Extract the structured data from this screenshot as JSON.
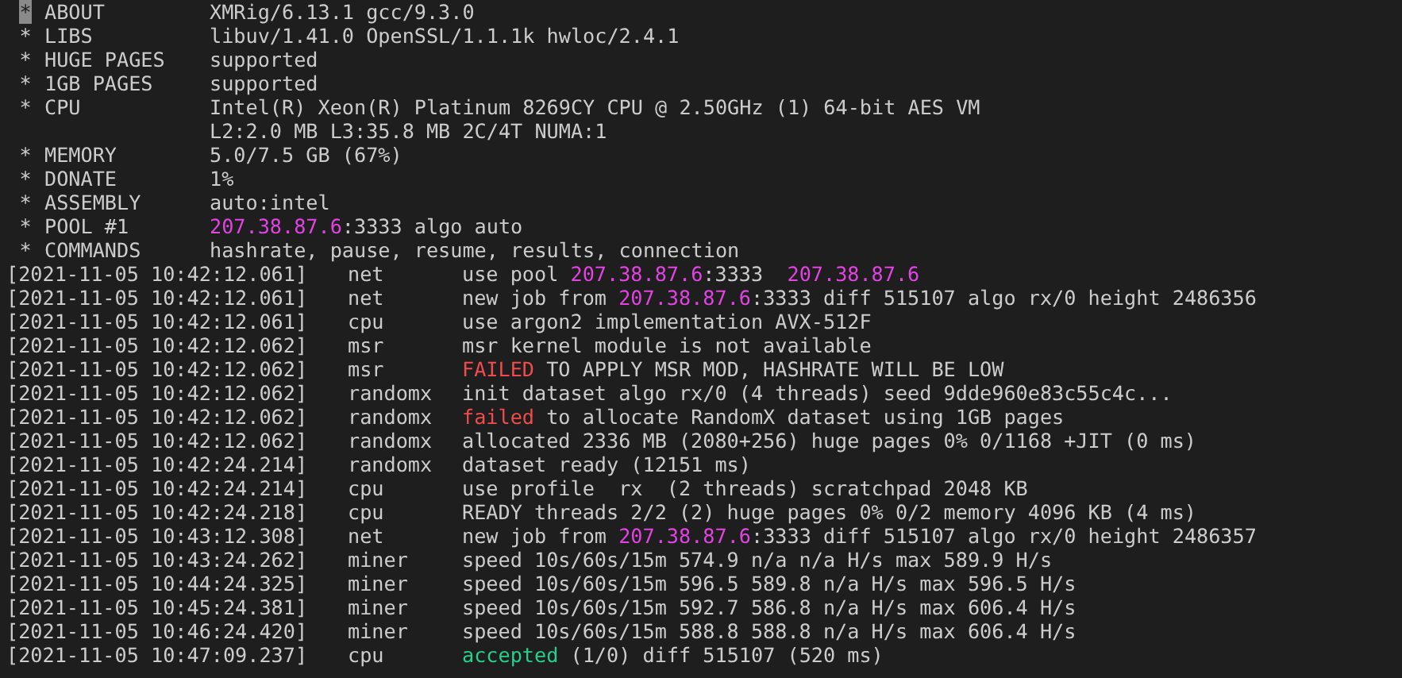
{
  "summary": [
    {
      "bullet": "*",
      "cursor": true,
      "label": "ABOUT",
      "value": [
        [
          {
            "text": "XMRig/6.13.1 gcc/9.3.0",
            "kind": "plain"
          }
        ]
      ]
    },
    {
      "bullet": "*",
      "cursor": false,
      "label": "LIBS",
      "value": [
        [
          {
            "text": "libuv/1.41.0 OpenSSL/1.1.1k hwloc/2.4.1",
            "kind": "plain"
          }
        ]
      ]
    },
    {
      "bullet": "*",
      "cursor": false,
      "label": "HUGE PAGES",
      "value": [
        [
          {
            "text": "supported",
            "kind": "plain"
          }
        ]
      ]
    },
    {
      "bullet": "*",
      "cursor": false,
      "label": "1GB PAGES",
      "value": [
        [
          {
            "text": "supported",
            "kind": "plain"
          }
        ]
      ]
    },
    {
      "bullet": "*",
      "cursor": false,
      "label": "CPU",
      "value": [
        [
          {
            "text": "Intel(R) Xeon(R) Platinum 8269CY CPU @ 2.50GHz (1) 64-bit AES VM",
            "kind": "plain"
          }
        ],
        [
          {
            "text": "L2:2.0 MB L3:35.8 MB 2C/4T NUMA:1",
            "kind": "plain"
          }
        ]
      ]
    },
    {
      "bullet": "*",
      "cursor": false,
      "label": "MEMORY",
      "value": [
        [
          {
            "text": "5.0/7.5 GB (67%)",
            "kind": "plain"
          }
        ]
      ]
    },
    {
      "bullet": "*",
      "cursor": false,
      "label": "DONATE",
      "value": [
        [
          {
            "text": "1%",
            "kind": "plain"
          }
        ]
      ]
    },
    {
      "bullet": "*",
      "cursor": false,
      "label": "ASSEMBLY",
      "value": [
        [
          {
            "text": "auto:intel",
            "kind": "plain"
          }
        ]
      ]
    },
    {
      "bullet": "*",
      "cursor": false,
      "label": "POOL #1",
      "value": [
        [
          {
            "text": "207.38.87.6",
            "kind": "host"
          },
          {
            "text": ":3333 algo auto",
            "kind": "plain"
          }
        ]
      ]
    },
    {
      "bullet": "*",
      "cursor": false,
      "label": "COMMANDS",
      "value": [
        [
          {
            "text": "hashrate, pause, resume, results, connection",
            "kind": "plain"
          }
        ]
      ]
    }
  ],
  "log": [
    {
      "time": "[2021-11-05 10:42:12.061]",
      "tag": "net",
      "message": [
        {
          "text": "use pool ",
          "kind": "plain"
        },
        {
          "text": "207.38.87.6",
          "kind": "host"
        },
        {
          "text": ":3333  ",
          "kind": "plain"
        },
        {
          "text": "207.38.87.6",
          "kind": "host"
        }
      ]
    },
    {
      "time": "[2021-11-05 10:42:12.061]",
      "tag": "net",
      "message": [
        {
          "text": "new job from ",
          "kind": "plain"
        },
        {
          "text": "207.38.87.6",
          "kind": "host"
        },
        {
          "text": ":3333 diff 515107 algo rx/0 height 2486356",
          "kind": "plain"
        }
      ]
    },
    {
      "time": "[2021-11-05 10:42:12.061]",
      "tag": "cpu",
      "message": [
        {
          "text": "use argon2 implementation AVX-512F",
          "kind": "plain"
        }
      ]
    },
    {
      "time": "[2021-11-05 10:42:12.062]",
      "tag": "msr",
      "message": [
        {
          "text": "msr kernel module is not available",
          "kind": "plain"
        }
      ]
    },
    {
      "time": "[2021-11-05 10:42:12.062]",
      "tag": "msr",
      "message": [
        {
          "text": "FAILED",
          "kind": "error"
        },
        {
          "text": " TO APPLY MSR MOD, HASHRATE WILL BE LOW",
          "kind": "plain"
        }
      ]
    },
    {
      "time": "[2021-11-05 10:42:12.062]",
      "tag": "randomx",
      "message": [
        {
          "text": "init dataset algo rx/0 (4 threads) seed 9dde960e83c55c4c...",
          "kind": "plain"
        }
      ]
    },
    {
      "time": "[2021-11-05 10:42:12.062]",
      "tag": "randomx",
      "message": [
        {
          "text": "failed",
          "kind": "error"
        },
        {
          "text": " to allocate RandomX dataset using 1GB pages",
          "kind": "plain"
        }
      ]
    },
    {
      "time": "[2021-11-05 10:42:12.062]",
      "tag": "randomx",
      "message": [
        {
          "text": "allocated 2336 MB (2080+256) huge pages 0% 0/1168 +JIT (0 ms)",
          "kind": "plain"
        }
      ]
    },
    {
      "time": "[2021-11-05 10:42:24.214]",
      "tag": "randomx",
      "message": [
        {
          "text": "dataset ready (12151 ms)",
          "kind": "plain"
        }
      ]
    },
    {
      "time": "[2021-11-05 10:42:24.214]",
      "tag": "cpu",
      "message": [
        {
          "text": "use profile  rx  (2 threads) scratchpad 2048 KB",
          "kind": "plain"
        }
      ]
    },
    {
      "time": "[2021-11-05 10:42:24.218]",
      "tag": "cpu",
      "message": [
        {
          "text": "READY threads 2/2 (2) huge pages 0% 0/2 memory 4096 KB (4 ms)",
          "kind": "plain"
        }
      ]
    },
    {
      "time": "[2021-11-05 10:43:12.308]",
      "tag": "net",
      "message": [
        {
          "text": "new job from ",
          "kind": "plain"
        },
        {
          "text": "207.38.87.6",
          "kind": "host"
        },
        {
          "text": ":3333 diff 515107 algo rx/0 height 2486357",
          "kind": "plain"
        }
      ]
    },
    {
      "time": "[2021-11-05 10:43:24.262]",
      "tag": "miner",
      "message": [
        {
          "text": "speed 10s/60s/15m 574.9 n/a n/a H/s max 589.9 H/s",
          "kind": "plain"
        }
      ]
    },
    {
      "time": "[2021-11-05 10:44:24.325]",
      "tag": "miner",
      "message": [
        {
          "text": "speed 10s/60s/15m 596.5 589.8 n/a H/s max 596.5 H/s",
          "kind": "plain"
        }
      ]
    },
    {
      "time": "[2021-11-05 10:45:24.381]",
      "tag": "miner",
      "message": [
        {
          "text": "speed 10s/60s/15m 592.7 586.8 n/a H/s max 606.4 H/s",
          "kind": "plain"
        }
      ]
    },
    {
      "time": "[2021-11-05 10:46:24.420]",
      "tag": "miner",
      "message": [
        {
          "text": "speed 10s/60s/15m 588.8 588.8 n/a H/s max 606.4 H/s",
          "kind": "plain"
        }
      ]
    },
    {
      "time": "[2021-11-05 10:47:09.237]",
      "tag": "cpu",
      "message": [
        {
          "text": "accepted",
          "kind": "success"
        },
        {
          "text": " (1/0) diff 515107 (520 ms)",
          "kind": "plain"
        }
      ]
    }
  ]
}
